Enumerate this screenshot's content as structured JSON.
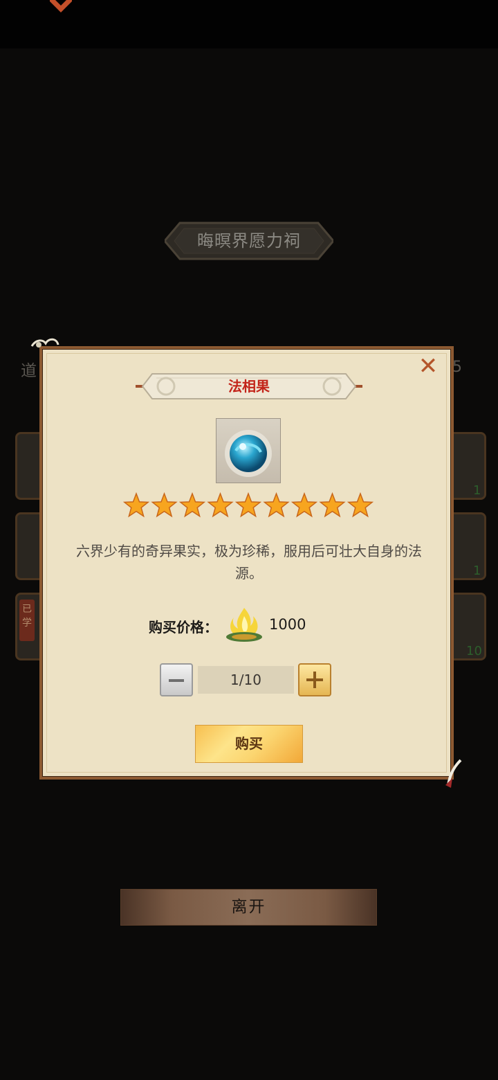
{
  "shop": {
    "title": "晦暝界愿力祠",
    "label_partial": "道",
    "count_partial": "5",
    "right_counts": [
      "1",
      "1",
      "10"
    ],
    "learned_tag": "已学"
  },
  "modal": {
    "item_name": "法相果",
    "close_icon": "close-icon",
    "star_count": 9,
    "description": "六界少有的奇异果实，极为珍稀，服用后可壮大自身的法源。",
    "price_label": "购买价格：",
    "price_value": "1000",
    "quantity": "1/10",
    "buy_label": "购买"
  },
  "footer": {
    "leave_label": "离开"
  },
  "colors": {
    "modal_bg": "#ede2c5",
    "frame": "#8d5a32",
    "accent_red": "#c3241a",
    "gold": "#f7bf4f"
  }
}
